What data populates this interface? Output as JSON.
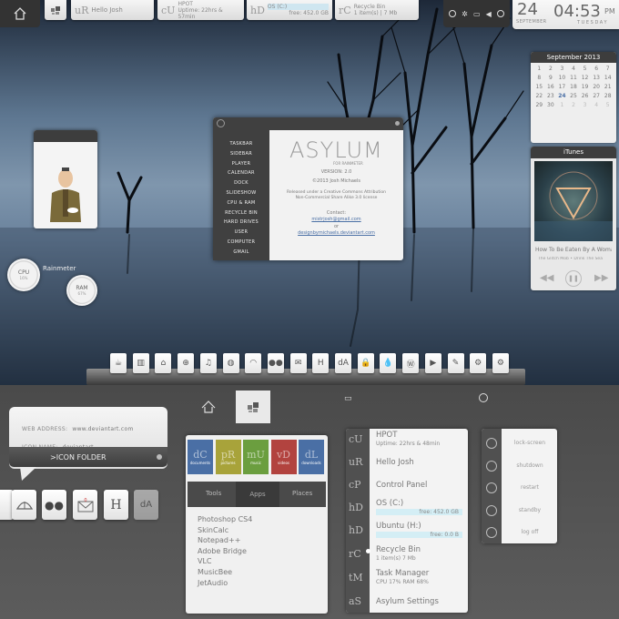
{
  "topbar": {
    "items": [
      {
        "letters": "uR",
        "label": "Hello Josh"
      },
      {
        "letters": "cU",
        "label": "HPOT",
        "sub": "Uptime: 22hrs & 57min"
      },
      {
        "letters": "hD",
        "label": "OS (C:)",
        "sub": "free: 452.0 GB"
      },
      {
        "letters": "rC",
        "label": "Recycle Bin",
        "sub": "1 item(s) | 7 Mb"
      }
    ]
  },
  "clock": {
    "day_num": "24",
    "month": "SEPTEMBER",
    "time": "04:53",
    "ampm": "PM",
    "weekday": "TUESDAY"
  },
  "calendar": {
    "title": "September 2013",
    "days": [
      "1",
      "2",
      "3",
      "4",
      "5",
      "6",
      "7",
      "8",
      "9",
      "10",
      "11",
      "12",
      "13",
      "14",
      "15",
      "16",
      "17",
      "18",
      "19",
      "20",
      "21",
      "22",
      "23",
      "24",
      "25",
      "26",
      "27",
      "28",
      "29",
      "30",
      "1",
      "2",
      "3",
      "4",
      "5"
    ]
  },
  "itunes": {
    "title": "iTunes",
    "song": "How To Be Eaten By A Woman",
    "artist": "The Glitch Mob • Drink The Sea"
  },
  "gauges": {
    "title": "Rainmeter",
    "cpu_label": "CPU",
    "cpu_val": "16%",
    "ram_label": "RAM",
    "ram_val": "67%"
  },
  "asylum": {
    "title": "ASYLUM",
    "subtitle": "FOR RAINMETER",
    "version": "VERSION: 2.0",
    "copyright": "©2013 Josh Michaels",
    "license1": "Released under a Creative Commons Attribution",
    "license2": "Non-Commercial Share Alike 3.0 license",
    "contact": "Contact:",
    "email": "mistrjosh@gmail.com",
    "or": "or",
    "site": "designbymichaels.deviantart.com",
    "menu": [
      "TASKBAR",
      "SIDEBAR",
      "PLAYER",
      "CALENDAR",
      "DOCK",
      "SLIDESHOW",
      "CPU & RAM",
      "RECYCLE BIN",
      "HARD DRIVES",
      "USER",
      "COMPUTER",
      "GMAIL"
    ]
  },
  "dock": {
    "icons": [
      "coffee",
      "folder",
      "home",
      "disk",
      "music",
      "globe",
      "trash",
      "flickr",
      "mail",
      "H",
      "dA",
      "lock",
      "drop",
      "wordpress",
      "youtube",
      "twitter",
      "steam",
      "settings"
    ]
  },
  "tip": {
    "web_label": "WEB ADDRESS:",
    "web_value": "www.deviantart.com",
    "name_label": "ICON NAME:",
    "name_value": "deviantart",
    "folder": ">ICON FOLDER"
  },
  "tiles": [
    {
      "letters": "dC",
      "label": "documents",
      "color": "#4a6fa5"
    },
    {
      "letters": "pR",
      "label": "pictures",
      "color": "#a8a33a"
    },
    {
      "letters": "mU",
      "label": "music",
      "color": "#6b9e3f"
    },
    {
      "letters": "vD",
      "label": "videos",
      "color": "#b2433f"
    },
    {
      "letters": "dL",
      "label": "downloads",
      "color": "#4a6fa5"
    }
  ],
  "subtabs": [
    "Tools",
    "Apps",
    "Places"
  ],
  "programs": [
    "Photoshop CS4",
    "SkinCalc",
    "Notepad++",
    "Adobe Bridge",
    "VLC",
    "MusicBee",
    "JetAudio"
  ],
  "drives": [
    {
      "letters": "cU",
      "title": "HPOT",
      "sub": "Uptime:    22hrs & 48min"
    },
    {
      "letters": "uR",
      "title": "Hello Josh",
      "sub": ""
    },
    {
      "letters": "cP",
      "title": "Control Panel",
      "sub": ""
    },
    {
      "letters": "hD",
      "title": "OS (C:)",
      "sub": "free: 452.0 GB"
    },
    {
      "letters": "hD",
      "title": "Ubuntu (H:)",
      "sub": "free: 0.0 B"
    },
    {
      "letters": "rC",
      "title": "Recycle Bin",
      "sub": "1 item(s)    7 Mb"
    },
    {
      "letters": "tM",
      "title": "Task Manager",
      "sub": "CPU 17%        RAM 68%"
    },
    {
      "letters": "aS",
      "title": "Asylum Settings",
      "sub": ""
    }
  ],
  "power": [
    "lock-screen",
    "shutdown",
    "restart",
    "standby",
    "log off"
  ]
}
